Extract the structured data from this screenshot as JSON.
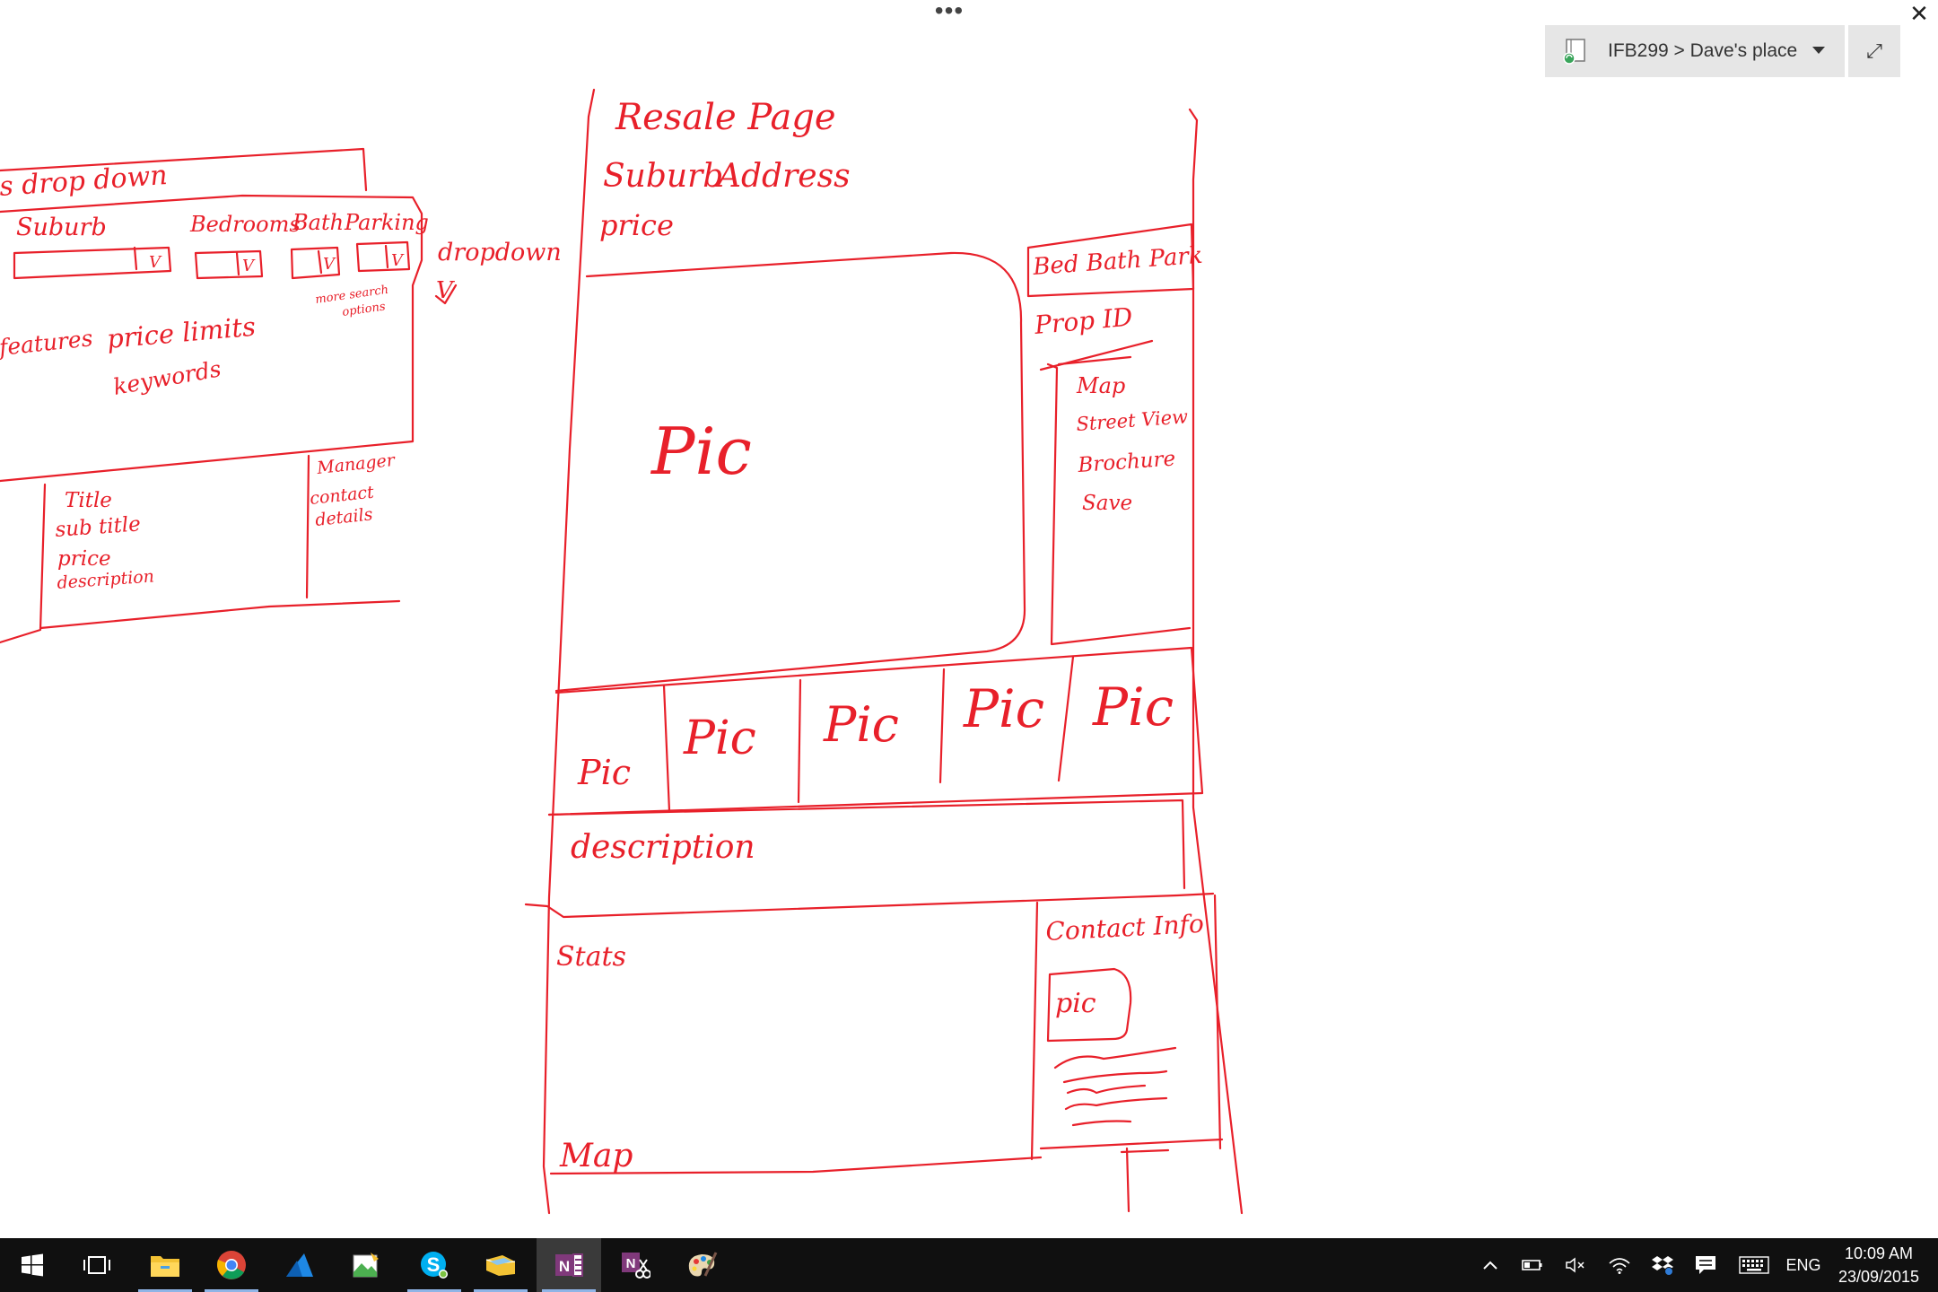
{
  "toolbar": {
    "more_label": "•••",
    "close_label": "✕",
    "notebook": {
      "label": "IFB299 > Dave's place",
      "icon": "notebook-sync-icon"
    },
    "fullscreen_icon": "expand-icon"
  },
  "sketch_left": {
    "dropdown_heading": "s drop down",
    "suburb": "Suburb",
    "bedrooms": "Bedrooms",
    "bath": "Bath",
    "parking": "Parking",
    "dropdown_note": "dropdown",
    "dropdown_arrow": "V",
    "more_search": [
      "more search",
      "options"
    ],
    "features": "features",
    "price_limits": "price limits",
    "keywords": "keywords",
    "listing": [
      "Title",
      "sub title",
      "price",
      "description"
    ],
    "manager": [
      "Manager",
      "contact",
      "details"
    ],
    "select_marker": "V"
  },
  "sketch_main": {
    "title": "Resale Page",
    "suburb": "Suburb",
    "address": "Address",
    "price": "price",
    "main_pic": "Pic",
    "bed_bath_park": "Bed Bath Park",
    "prop_id": "Prop ID",
    "side_menu": [
      "Map",
      "Street View",
      "Brochure",
      "Save"
    ],
    "thumbnails": [
      "Pic",
      "Pic",
      "Pic",
      "Pic",
      "Pic"
    ],
    "description": "description",
    "stats": "Stats",
    "contact_info": "Contact Info",
    "contact_pic": "pic",
    "map": "Map"
  },
  "taskbar": {
    "apps": [
      {
        "name": "start-icon"
      },
      {
        "name": "task-view-icon"
      },
      {
        "name": "file-explorer-icon"
      },
      {
        "name": "chrome-icon"
      },
      {
        "name": "azure-icon"
      },
      {
        "name": "image-editor-icon"
      },
      {
        "name": "skype-icon"
      },
      {
        "name": "folder-icon"
      },
      {
        "name": "onenote-icon"
      },
      {
        "name": "onenote-clipper-icon"
      },
      {
        "name": "paint-icon"
      }
    ],
    "tray": {
      "language": "ENG",
      "time": "10:09 AM",
      "date": "23/09/2015"
    }
  }
}
